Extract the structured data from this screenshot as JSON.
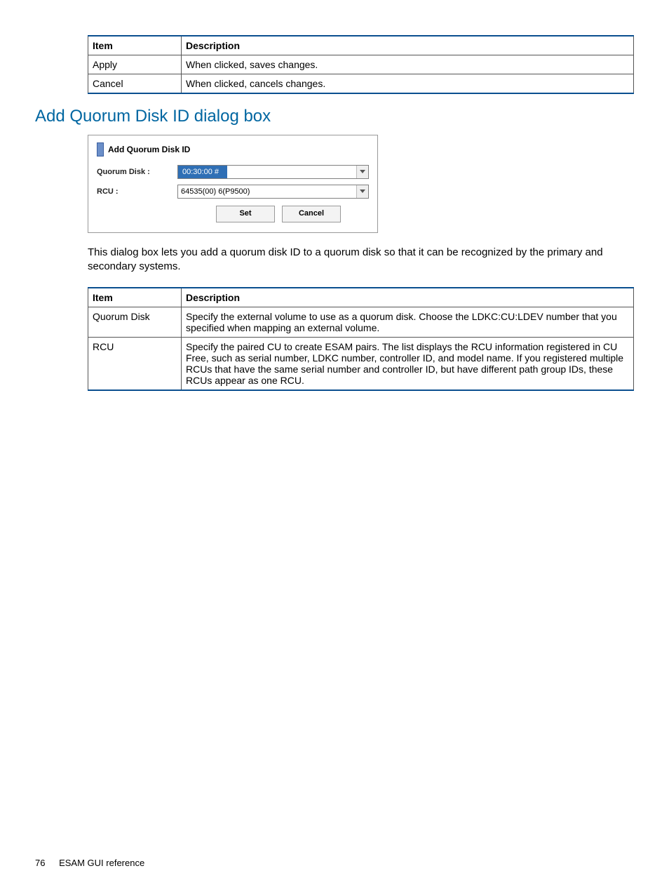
{
  "table1": {
    "headers": {
      "item": "Item",
      "desc": "Description"
    },
    "rows": [
      {
        "item": "Apply",
        "desc": "When clicked, saves changes."
      },
      {
        "item": "Cancel",
        "desc": "When clicked, cancels changes."
      }
    ]
  },
  "section_heading": "Add Quorum Disk ID dialog box",
  "dialog": {
    "title": "Add Quorum Disk ID",
    "rows": [
      {
        "label": "Quorum Disk :",
        "value": "00:30:00 #",
        "highlight": true
      },
      {
        "label": "RCU :",
        "value": "64535(00) 6(P9500)",
        "highlight": false
      }
    ],
    "buttons": {
      "set": "Set",
      "cancel": "Cancel"
    }
  },
  "intro": "This dialog box lets you add a quorum disk ID to a quorum disk so that it can be recognized by the primary and secondary systems.",
  "table2": {
    "headers": {
      "item": "Item",
      "desc": "Description"
    },
    "rows": [
      {
        "item": "Quorum Disk",
        "desc": "Specify the external volume to use as a quorum disk. Choose the LDKC:CU:LDEV number that you specified when mapping an external volume."
      },
      {
        "item": "RCU",
        "desc": "Specify the paired CU to create ESAM pairs. The list displays the RCU information registered in CU Free, such as serial number, LDKC number, controller ID, and model name. If you registered multiple RCUs that have the same serial number and controller ID, but have different path group IDs, these RCUs appear as one RCU."
      }
    ]
  },
  "footer": {
    "page": "76",
    "section": "ESAM GUI reference"
  }
}
